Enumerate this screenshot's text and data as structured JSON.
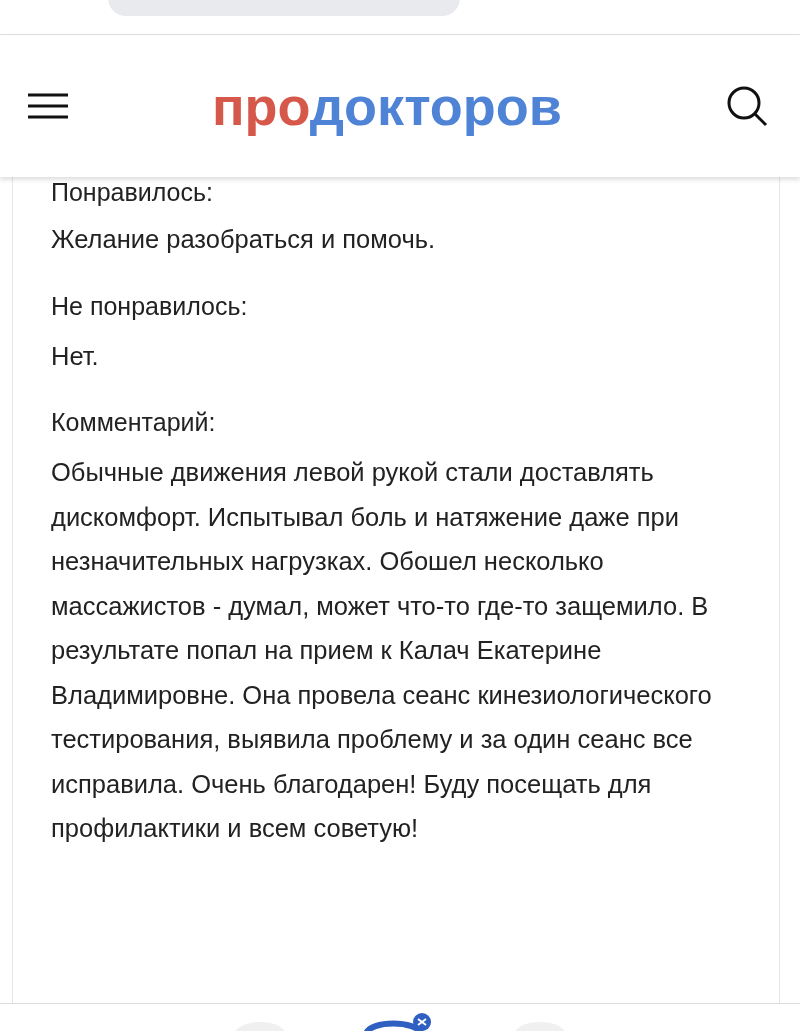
{
  "header": {
    "logo": {
      "part_1": "про",
      "part_2": "докторов"
    }
  },
  "review": {
    "sections": [
      {
        "heading": "Понравилось:",
        "text": "Желание разобраться и помочь."
      },
      {
        "heading": "Не понравилось:",
        "text": "Нет."
      },
      {
        "heading": "Комментарий:",
        "text": "Обычные движения левой рукой стали доставлять дискомфорт. Испытывал боль и натяжение даже при незначительных нагрузках. Обошел несколько массажистов - думал, может что-то где-то защемило. В результате попал на прием к Калач Екатерине Владимировне. Она провела сеанс кинезиологического тестирования, выявила проблему и за один сеанс все исправила. Очень благодарен! Буду посещать для профилактики и всем советую!"
      }
    ]
  }
}
